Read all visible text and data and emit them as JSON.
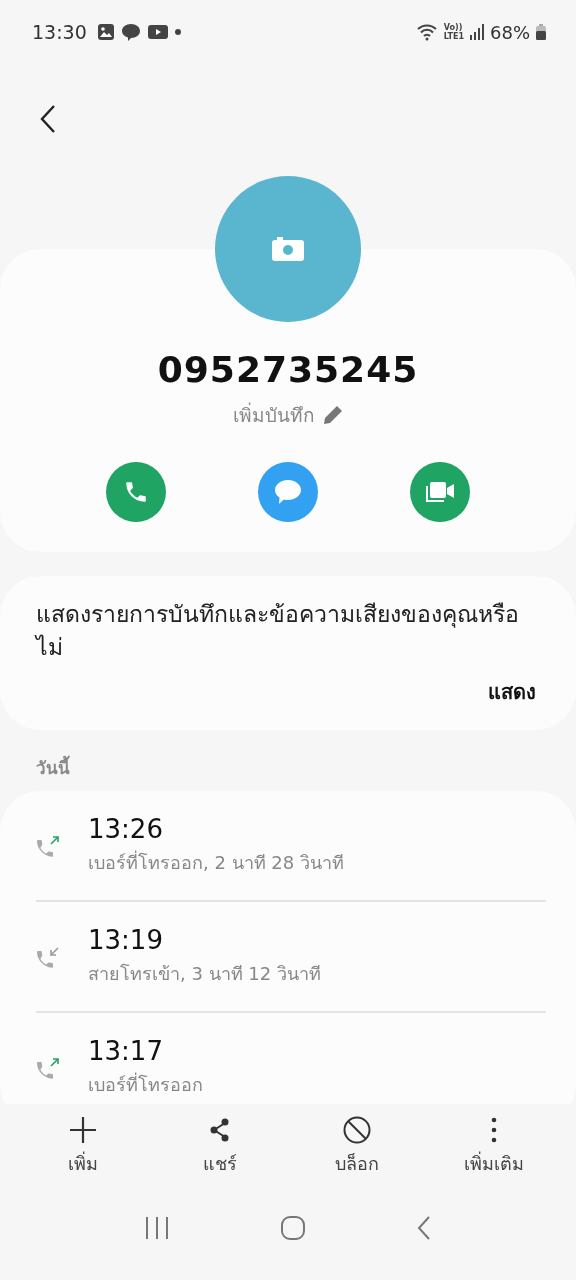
{
  "status_bar": {
    "time": "13:30",
    "volte": "Vo))",
    "network": "LTE1",
    "battery": "68%"
  },
  "contact": {
    "number": "0952735245",
    "note": "เพิ่มบันทึก"
  },
  "prompt": {
    "text": "แสดงรายการบันทึกและข้อความเสียงของคุณหรือไม่",
    "action": "แสดง"
  },
  "section_title": "วันนี้",
  "calls": [
    {
      "time": "13:26",
      "detail": "เบอร์ที่โทรออก, 2 นาที 28 วินาที",
      "kind": "outgoing"
    },
    {
      "time": "13:19",
      "detail": "สายโทรเข้า, 3 นาที 12 วินาที",
      "kind": "incoming"
    },
    {
      "time": "13:17",
      "detail": "เบอร์ที่โทรออก",
      "kind": "outgoing"
    }
  ],
  "toolbar": [
    {
      "label": "เพิ่ม",
      "kind": "add"
    },
    {
      "label": "แชร์",
      "kind": "share"
    },
    {
      "label": "บล็อก",
      "kind": "block"
    },
    {
      "label": "เพิ่มเติม",
      "kind": "more"
    }
  ]
}
